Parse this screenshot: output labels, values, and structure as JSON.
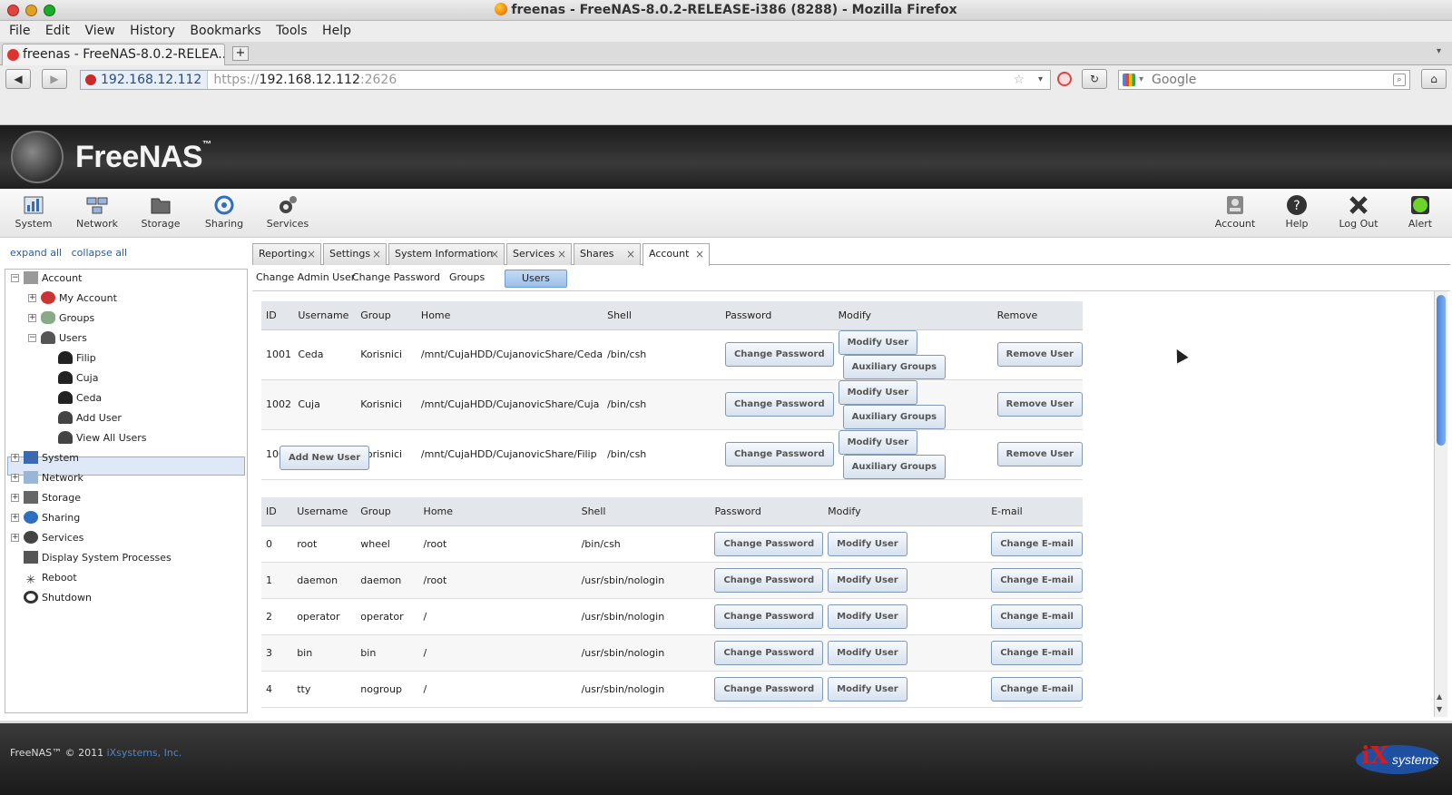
{
  "window": {
    "title": "freenas - FreeNAS-8.0.2-RELEASE-i386 (8288) - Mozilla Firefox"
  },
  "menu": [
    "File",
    "Edit",
    "View",
    "History",
    "Bookmarks",
    "Tools",
    "Help"
  ],
  "browser_tab": {
    "label": "freenas - FreeNAS-8.0.2-RELEA..."
  },
  "address": {
    "site": "192.168.12.112",
    "scheme": "https://",
    "host": "192.168.12.112",
    "port": ":2626"
  },
  "search": {
    "placeholder": "Google"
  },
  "app": {
    "logo_text": "FreeNAS",
    "tm": "™"
  },
  "topnav": {
    "left": [
      "System",
      "Network",
      "Storage",
      "Sharing",
      "Services"
    ],
    "right": [
      "Account",
      "Help",
      "Log Out",
      "Alert"
    ]
  },
  "sidebar": {
    "expand_all": "expand all",
    "collapse_all": "collapse all",
    "items": [
      "Account",
      "My Account",
      "Groups",
      "Users",
      "Filip",
      "Cuja",
      "Ceda",
      "Add User",
      "View All Users",
      "System",
      "Network",
      "Storage",
      "Sharing",
      "Services",
      "Display System Processes",
      "Reboot",
      "Shutdown"
    ]
  },
  "tabs": [
    "Reporting",
    "Settings",
    "System Information",
    "Services",
    "Shares",
    "Account"
  ],
  "subtabs": [
    "Change Admin User",
    "Change Password",
    "Groups",
    "Users"
  ],
  "table1": {
    "headers": [
      "ID",
      "Username",
      "Group",
      "Home",
      "Shell",
      "Password",
      "Modify",
      "Remove"
    ],
    "rows": [
      [
        "1001",
        "Ceda",
        "Korisnici",
        "/mnt/CujaHDD/CujanovicShare/Ceda",
        "/bin/csh"
      ],
      [
        "1002",
        "Cuja",
        "Korisnici",
        "/mnt/CujaHDD/CujanovicShare/Cuja",
        "/bin/csh"
      ],
      [
        "1003",
        "Filip",
        "Korisnici",
        "/mnt/CujaHDD/CujanovicShare/Filip",
        "/bin/csh"
      ]
    ],
    "buttons": {
      "password": "Change Password",
      "modify": "Modify User",
      "aux": "Auxiliary Groups",
      "remove": "Remove User"
    }
  },
  "add_new_user": "Add New User",
  "table2": {
    "headers": [
      "ID",
      "Username",
      "Group",
      "Home",
      "Shell",
      "Password",
      "Modify",
      "E-mail"
    ],
    "rows": [
      [
        "0",
        "root",
        "wheel",
        "/root",
        "/bin/csh"
      ],
      [
        "1",
        "daemon",
        "daemon",
        "/root",
        "/usr/sbin/nologin"
      ],
      [
        "2",
        "operator",
        "operator",
        "/",
        "/usr/sbin/nologin"
      ],
      [
        "3",
        "bin",
        "bin",
        "/",
        "/usr/sbin/nologin"
      ],
      [
        "4",
        "tty",
        "nogroup",
        "/",
        "/usr/sbin/nologin"
      ]
    ],
    "buttons": {
      "password": "Change Password",
      "modify": "Modify User",
      "email": "Change E-mail"
    }
  },
  "footer": {
    "copyright": "FreeNAS™ © 2011 ",
    "company": "iXsystems, Inc.",
    "logo_text": "systems"
  },
  "colors": {
    "accent": "#2f5b9a",
    "header_bg": "#1b1b1b",
    "selected": "#dfe8f6"
  }
}
